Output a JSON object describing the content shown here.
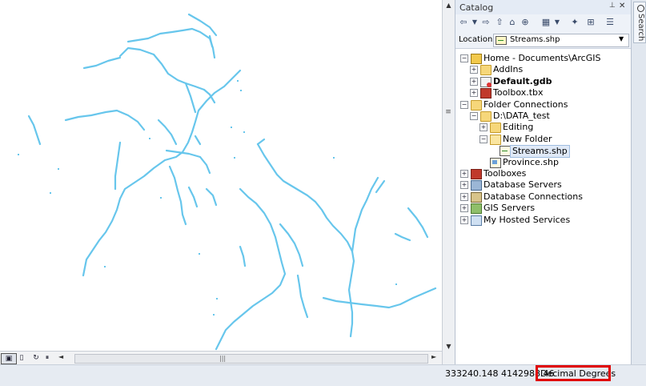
{
  "catalog": {
    "title": "Catalog",
    "toolbar_icons": [
      "back-icon",
      "dropdown-icon",
      "forward-icon",
      "up-icon",
      "home-icon",
      "connect-folder-icon",
      "disconnect-folder-icon",
      "view-icon",
      "view-dropdown-icon",
      "new-icon",
      "toggle-tree-icon",
      "options-icon"
    ],
    "location_label": "Location:",
    "location_value": "Streams.shp"
  },
  "tree": [
    {
      "label": "Home - Documents\\ArcGIS",
      "icon": "home-folder-icon",
      "level": 0,
      "exp": "−"
    },
    {
      "label": "AddIns",
      "icon": "folder-icon",
      "level": 1,
      "exp": "+"
    },
    {
      "label": "Default.gdb",
      "icon": "geodatabase-icon",
      "level": 1,
      "exp": "+",
      "bold": true
    },
    {
      "label": "Toolbox.tbx",
      "icon": "toolbox-icon",
      "level": 1,
      "exp": "+"
    },
    {
      "label": "Folder Connections",
      "icon": "folder-connection-icon",
      "level": 0,
      "exp": "−"
    },
    {
      "label": "D:\\DATA_test",
      "icon": "folder-icon",
      "level": 1,
      "exp": "−"
    },
    {
      "label": "Editing",
      "icon": "folder-icon",
      "level": 2,
      "exp": "+"
    },
    {
      "label": "New Folder",
      "icon": "folder-open-icon",
      "level": 2,
      "exp": "−"
    },
    {
      "label": "Streams.shp",
      "icon": "line-shapefile-icon",
      "level": 3,
      "exp": "",
      "selected": true
    },
    {
      "label": "Province.shp",
      "icon": "polygon-shapefile-icon",
      "level": 2,
      "exp": ""
    },
    {
      "label": "Toolboxes",
      "icon": "toolboxes-icon",
      "level": 0,
      "exp": "+"
    },
    {
      "label": "Database Servers",
      "icon": "database-server-icon",
      "level": 0,
      "exp": "+"
    },
    {
      "label": "Database Connections",
      "icon": "database-connection-icon",
      "level": 0,
      "exp": "+"
    },
    {
      "label": "GIS Servers",
      "icon": "gis-server-icon",
      "level": 0,
      "exp": "+"
    },
    {
      "label": "My Hosted Services",
      "icon": "hosted-services-icon",
      "level": 0,
      "exp": "+"
    }
  ],
  "search_tab": "Search",
  "status": {
    "coordinates": "333240.148  4142988.46",
    "units": "Decimal Degrees"
  },
  "colors": {
    "stream": "#67c6ec",
    "highlight": "#e00000"
  }
}
